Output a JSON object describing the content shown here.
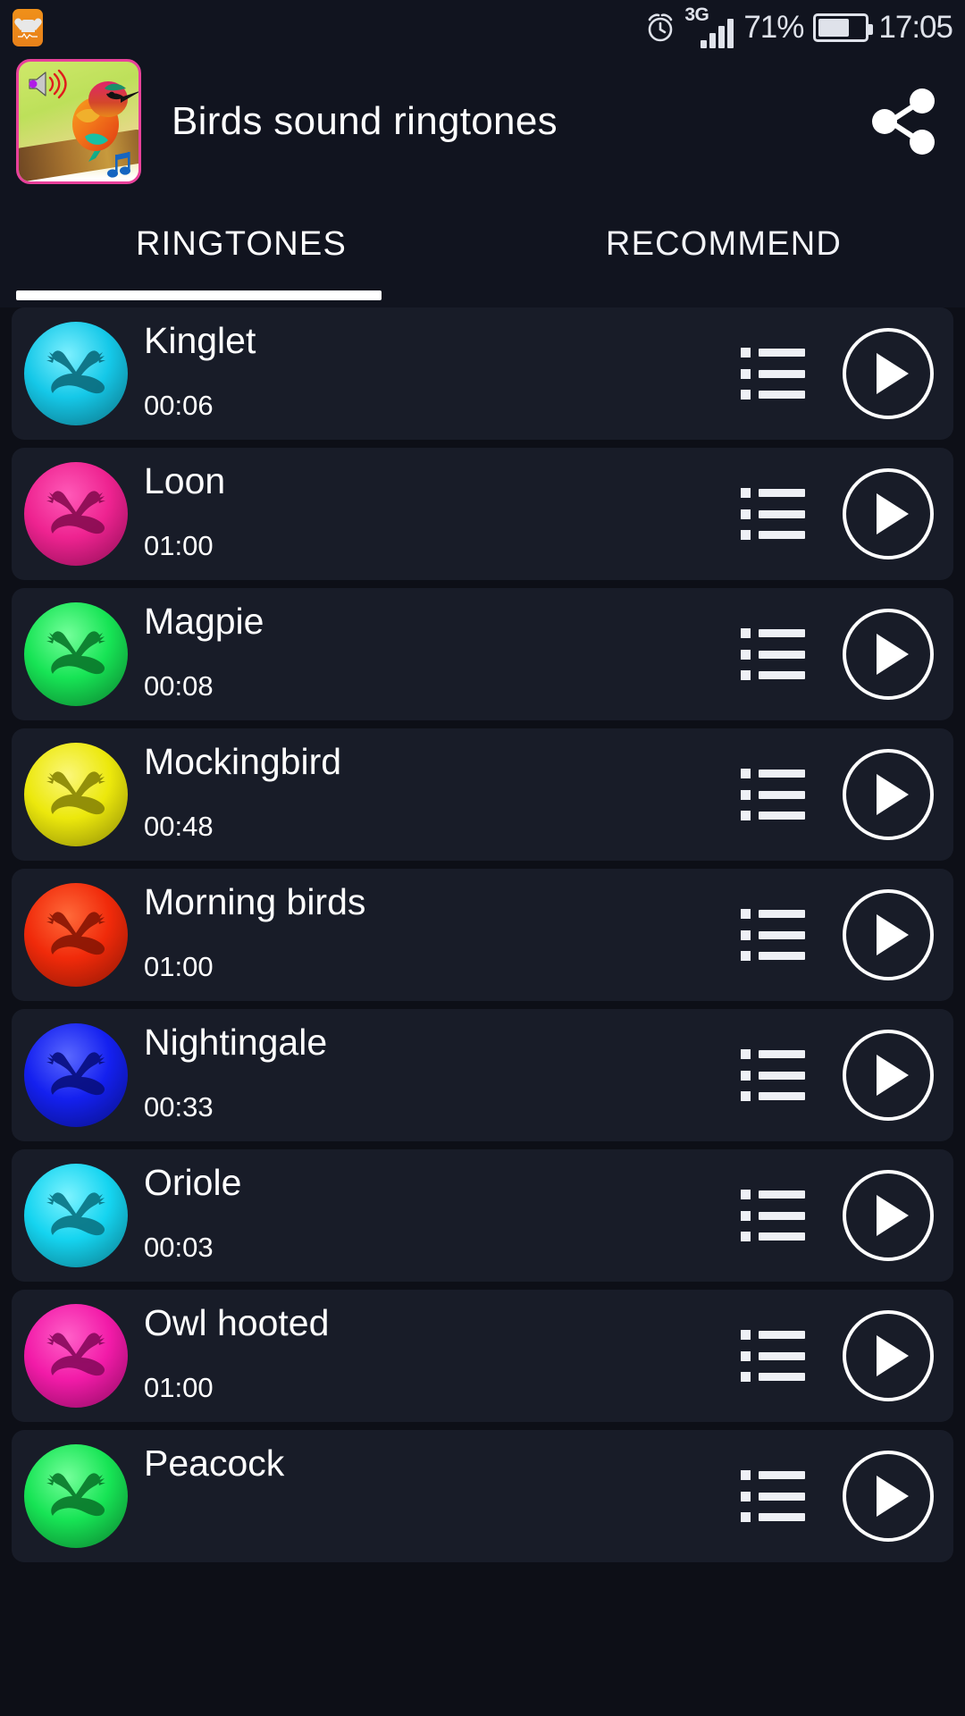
{
  "status_bar": {
    "notification_icon": "health-heart-icon",
    "alarm_icon": "alarm-clock-icon",
    "network_type": "3G",
    "signal_icon": "signal-bars-icon",
    "battery_percent": "71%",
    "battery_icon": "battery-icon",
    "time": "17:05"
  },
  "app_bar": {
    "app_icon": "bird-app-icon",
    "title": "Birds sound ringtones",
    "share_icon": "share-icon"
  },
  "tabs": [
    {
      "label": "RINGTONES",
      "active": true
    },
    {
      "label": "RECOMMEND",
      "active": false
    }
  ],
  "colors": {
    "background": "#0d0f17",
    "row_background": "#181c28",
    "header_background": "#11141f",
    "text": "#ffffff",
    "accent": "#ffffff",
    "app_icon_border": "#e8409a"
  },
  "ringtones": [
    {
      "title": "Kinglet",
      "duration": "00:06",
      "color": "#15c8e8",
      "color_light": "#7df0ff",
      "color_dark": "#0b6e80"
    },
    {
      "title": "Loon",
      "duration": "01:00",
      "color": "#ee2390",
      "color_light": "#ff5ab8",
      "color_dark": "#8a0c52"
    },
    {
      "title": "Magpie",
      "duration": "00:08",
      "color": "#17e455",
      "color_light": "#74ff9a",
      "color_dark": "#0a7a2c"
    },
    {
      "title": "Mockingbird",
      "duration": "00:48",
      "color": "#ece80c",
      "color_light": "#fbf77a",
      "color_dark": "#8a8705"
    },
    {
      "title": "Morning birds",
      "duration": "01:00",
      "color": "#f02a0a",
      "color_light": "#ff6a3a",
      "color_dark": "#8a1604"
    },
    {
      "title": "Nightingale",
      "duration": "00:33",
      "color": "#1420ef",
      "color_light": "#5a68ff",
      "color_dark": "#080f80"
    },
    {
      "title": "Oriole",
      "duration": "00:03",
      "color": "#15d4f0",
      "color_light": "#7df3ff",
      "color_dark": "#0a7686"
    },
    {
      "title": "Owl hooted",
      "duration": "01:00",
      "color": "#f21ba8",
      "color_light": "#ff60c8",
      "color_dark": "#8a0a5e"
    },
    {
      "title": "Peacock",
      "duration": "",
      "color": "#17e455",
      "color_light": "#74ff9a",
      "color_dark": "#0a7a2c"
    }
  ],
  "row_actions": {
    "list_icon": "list-icon",
    "play_icon": "play-icon"
  }
}
